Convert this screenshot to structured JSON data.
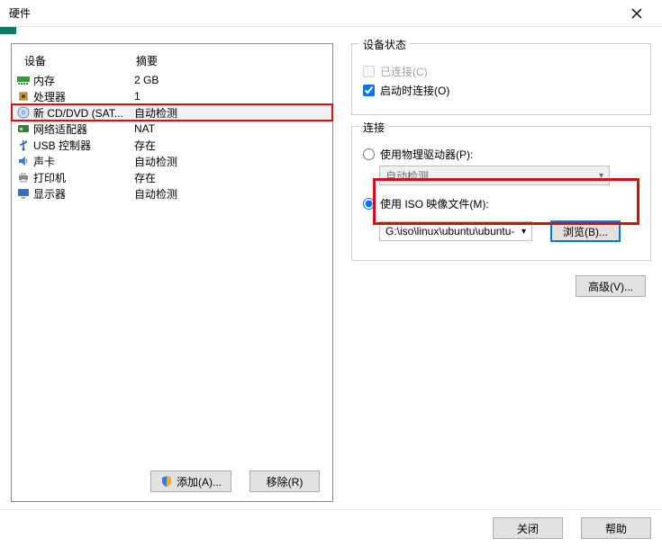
{
  "title": "硬件",
  "columns": {
    "device": "设备",
    "summary": "摘要"
  },
  "devices": [
    {
      "icon": "memory",
      "name": "内存",
      "summary": "2 GB"
    },
    {
      "icon": "cpu",
      "name": "处理器",
      "summary": "1"
    },
    {
      "icon": "disc",
      "name": "新 CD/DVD (SAT...",
      "summary": "自动检测"
    },
    {
      "icon": "nic",
      "name": "网络适配器",
      "summary": "NAT"
    },
    {
      "icon": "usb",
      "name": "USB 控制器",
      "summary": "存在"
    },
    {
      "icon": "sound",
      "name": "声卡",
      "summary": "自动检测"
    },
    {
      "icon": "printer",
      "name": "打印机",
      "summary": "存在"
    },
    {
      "icon": "display",
      "name": "显示器",
      "summary": "自动检测"
    }
  ],
  "buttons": {
    "add": "添加(A)...",
    "remove": "移除(R)"
  },
  "status": {
    "legend": "设备状态",
    "connected": "已连接(C)",
    "autoconnect": "启动时连接(O)"
  },
  "connection": {
    "legend": "连接",
    "physical": "使用物理驱动器(P):",
    "physical_value": "自动检测",
    "iso": "使用 ISO 映像文件(M):",
    "iso_path": "G:\\iso\\linux\\ubuntu\\ubuntu-",
    "browse": "浏览(B)..."
  },
  "advanced": "高级(V)...",
  "footer": {
    "close": "关闭",
    "help": "帮助"
  }
}
